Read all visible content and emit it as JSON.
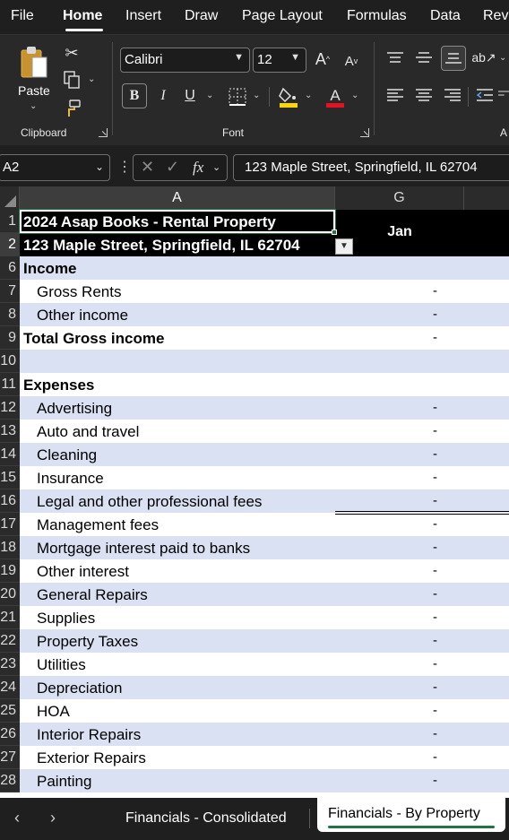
{
  "menu": {
    "items": [
      "File",
      "Home",
      "Insert",
      "Draw",
      "Page Layout",
      "Formulas",
      "Data",
      "Rev"
    ],
    "active": "Home"
  },
  "ribbon": {
    "clipboard": {
      "paste_label": "Paste",
      "group_label": "Clipboard"
    },
    "font": {
      "font_name": "Calibri",
      "font_size": "12",
      "bold": "B",
      "italic": "I",
      "underline": "U",
      "group_label": "Font",
      "highlight_color": "#ffd700",
      "font_color": "#e81123"
    },
    "alignment": {
      "group_label": "A"
    }
  },
  "formula_bar": {
    "name_box": "A2",
    "fx": "fx",
    "formula": "123 Maple Street, Springfield, IL 62704"
  },
  "grid": {
    "columns": [
      "A",
      "G"
    ],
    "jan_header": "Jan",
    "rows": [
      {
        "num": "1",
        "a": "2024 Asap Books - Rental Property",
        "g": ""
      },
      {
        "num": "2",
        "a": "123 Maple Street, Springfield, IL 62704",
        "g": ""
      },
      {
        "num": "6",
        "a": "Income",
        "g": ""
      },
      {
        "num": "7",
        "a": "Gross Rents",
        "g": "-"
      },
      {
        "num": "8",
        "a": "Other income",
        "g": "-"
      },
      {
        "num": "9",
        "a": "Total Gross income",
        "g": "-"
      },
      {
        "num": "10",
        "a": "",
        "g": ""
      },
      {
        "num": "11",
        "a": "Expenses",
        "g": ""
      },
      {
        "num": "12",
        "a": "Advertising",
        "g": "-"
      },
      {
        "num": "13",
        "a": "Auto and travel",
        "g": "-"
      },
      {
        "num": "14",
        "a": "Cleaning",
        "g": "-"
      },
      {
        "num": "15",
        "a": "Insurance",
        "g": "-"
      },
      {
        "num": "16",
        "a": "Legal and other professional fees",
        "g": "-"
      },
      {
        "num": "17",
        "a": "Management fees",
        "g": "-"
      },
      {
        "num": "18",
        "a": "Mortgage interest paid to banks",
        "g": "-"
      },
      {
        "num": "19",
        "a": "Other interest",
        "g": "-"
      },
      {
        "num": "20",
        "a": "General Repairs",
        "g": "-"
      },
      {
        "num": "21",
        "a": "Supplies",
        "g": "-"
      },
      {
        "num": "22",
        "a": "Property Taxes",
        "g": "-"
      },
      {
        "num": "23",
        "a": "Utilities",
        "g": "-"
      },
      {
        "num": "24",
        "a": "Depreciation",
        "g": "-"
      },
      {
        "num": "25",
        "a": "HOA",
        "g": "-"
      },
      {
        "num": "26",
        "a": "Interior Repairs",
        "g": "-"
      },
      {
        "num": "27",
        "a": "Exterior Repairs",
        "g": "-"
      },
      {
        "num": "28",
        "a": "Painting",
        "g": "-"
      }
    ]
  },
  "sheet_tabs": {
    "tabs": [
      "Financials - Consolidated",
      "Financials - By Property"
    ],
    "active": "Financials - By Property"
  }
}
